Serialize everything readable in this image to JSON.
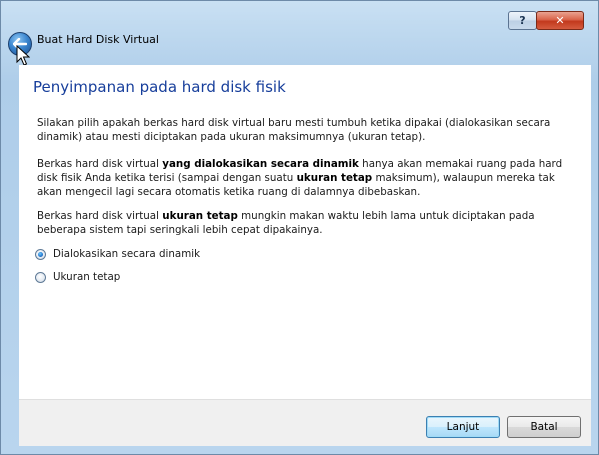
{
  "window": {
    "title": "Buat Hard Disk Virtual",
    "help_label": "?",
    "close_label": "✕"
  },
  "content": {
    "heading": "Penyimpanan pada hard disk fisik",
    "para1": "Silakan pilih apakah berkas hard disk virtual baru mesti tumbuh ketika dipakai (dialokasikan secara dinamik) atau mesti diciptakan pada ukuran maksimumnya (ukuran tetap).",
    "para2": {
      "a": "Berkas hard disk virtual ",
      "b": "yang dialokasikan secara dinamik",
      "c": " hanya akan memakai ruang pada hard disk fisik Anda ketika terisi (sampai dengan suatu ",
      "d": "ukuran tetap",
      "e": " maksimum), walaupun mereka tak akan mengecil lagi secara otomatis ketika ruang di dalamnya dibebaskan."
    },
    "para3": {
      "a": "Berkas hard disk virtual ",
      "b": "ukuran tetap",
      "c": " mungkin makan waktu lebih lama untuk diciptakan pada beberapa sistem tapi seringkali lebih cepat dipakainya."
    },
    "options": [
      {
        "label": "Dialokasikan secara dinamik",
        "selected": true
      },
      {
        "label": "Ukuran tetap",
        "selected": false
      }
    ]
  },
  "footer": {
    "next_label": "Lanjut",
    "cancel_label": "Batal"
  },
  "colors": {
    "heading": "#173e9b",
    "frame": "#aecde9",
    "footer": "#f0f0f0"
  }
}
